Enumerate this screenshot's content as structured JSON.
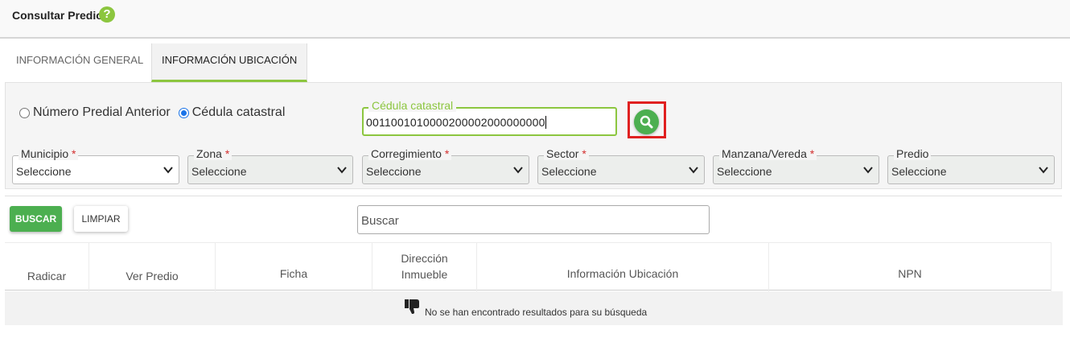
{
  "header": {
    "title": "Consultar Predio",
    "help_icon": "question-circle-icon",
    "help_glyph": "?"
  },
  "tabs": [
    {
      "label": "INFORMACIÓN GENERAL",
      "active": false
    },
    {
      "label": "INFORMACIÓN UBICACIÓN",
      "active": true
    }
  ],
  "search_mode": {
    "options": [
      {
        "label": "Número Predial Anterior",
        "checked": false
      },
      {
        "label": "Cédula catastral",
        "checked": true
      }
    ]
  },
  "cedula": {
    "label": "Cédula catastral",
    "value": "0011001010000200002000000000"
  },
  "filters": [
    {
      "label": "Municipio",
      "required": true,
      "value": "Seleccione"
    },
    {
      "label": "Zona",
      "required": true,
      "value": "Seleccione"
    },
    {
      "label": "Corregimiento",
      "required": true,
      "value": "Seleccione"
    },
    {
      "label": "Sector",
      "required": true,
      "value": "Seleccione"
    },
    {
      "label": "Manzana/Vereda",
      "required": true,
      "value": "Seleccione"
    },
    {
      "label": "Predio",
      "required": false,
      "value": "Seleccione"
    }
  ],
  "required_marker": "*",
  "actions": {
    "buscar": "BUSCAR",
    "limpiar": "LIMPIAR"
  },
  "table_search": {
    "placeholder": "Buscar"
  },
  "table": {
    "columns": [
      {
        "line1": "Radicar"
      },
      {
        "line1": "Ver Predio"
      },
      {
        "line1": "Ficha"
      },
      {
        "line1": "Dirección",
        "line2": "Inmueble"
      },
      {
        "line1": "Información Ubicación"
      },
      {
        "line1": "NPN"
      }
    ],
    "empty_message": "No se han encontrado resultados para su búsqueda"
  },
  "colors": {
    "accent": "#8cc63f",
    "primary_button": "#4caf50",
    "highlight": "#e02020"
  }
}
